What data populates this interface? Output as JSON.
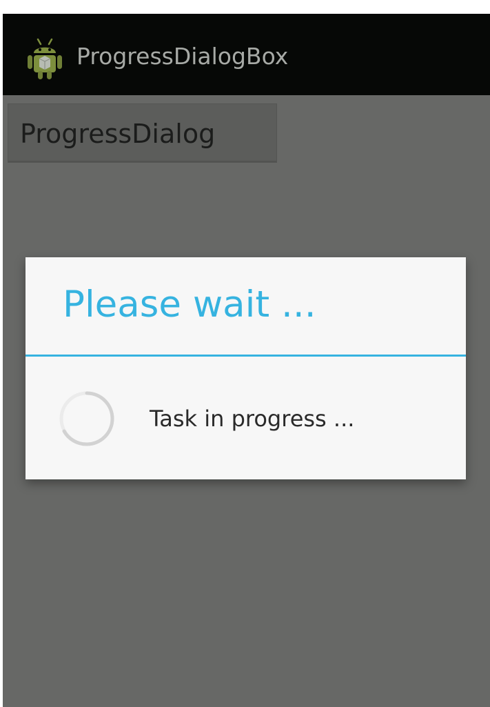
{
  "action_bar": {
    "title": "ProgressDialogBox",
    "icon": "android-robot-icon",
    "background": "#060806",
    "title_color": "#a7aaa6"
  },
  "main": {
    "button_label": "ProgressDialog",
    "background": "#676866"
  },
  "dialog": {
    "title": "Please wait ...",
    "message": "Task in progress ...",
    "accent_color": "#36b3e0",
    "spinner_icon": "progress-spinner-icon"
  }
}
